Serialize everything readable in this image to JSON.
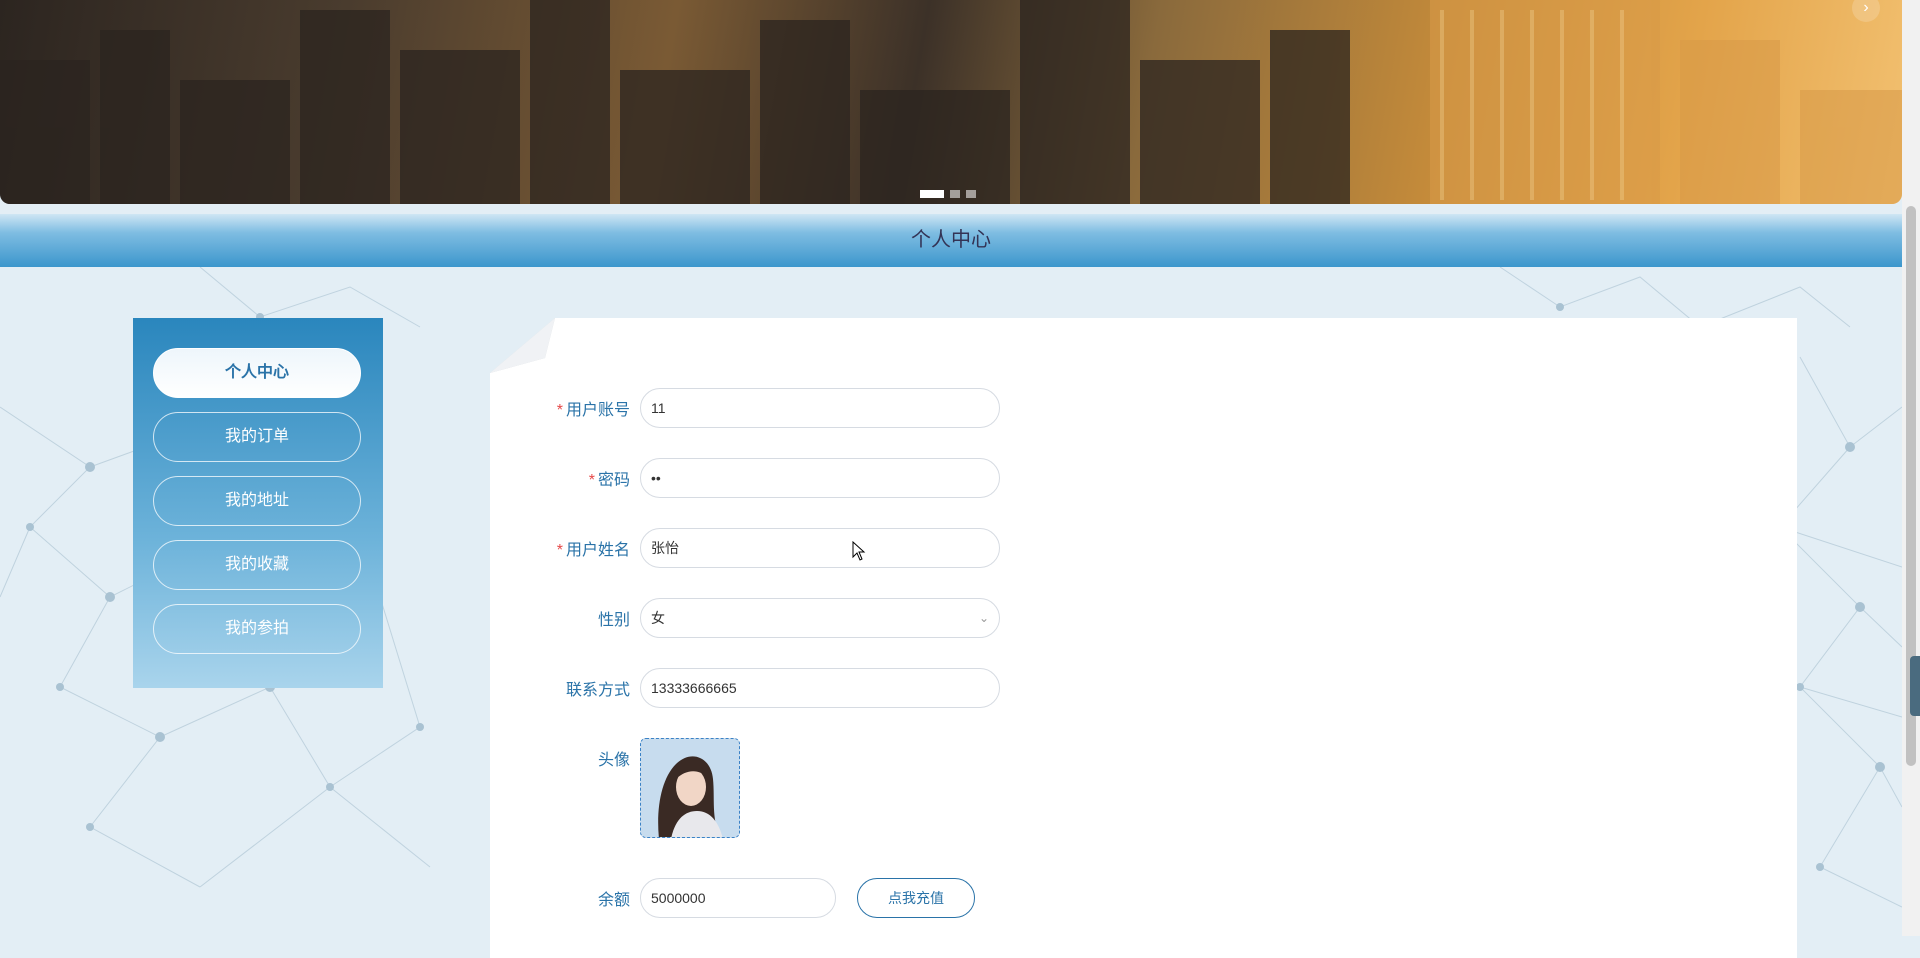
{
  "header": {
    "title": "个人中心"
  },
  "carousel": {
    "slide_count": 3,
    "active_index": 0,
    "arrow_label": "›"
  },
  "sidebar": {
    "items": [
      {
        "label": "个人中心",
        "active": true
      },
      {
        "label": "我的订单",
        "active": false
      },
      {
        "label": "我的地址",
        "active": false
      },
      {
        "label": "我的收藏",
        "active": false
      },
      {
        "label": "我的参拍",
        "active": false
      }
    ]
  },
  "form": {
    "account": {
      "label": "用户账号",
      "required": "*",
      "value": "11"
    },
    "password": {
      "label": "密码",
      "required": "*",
      "value": "••"
    },
    "name": {
      "label": "用户姓名",
      "required": "*",
      "value": "张怡"
    },
    "gender": {
      "label": "性别",
      "value": "女"
    },
    "phone": {
      "label": "联系方式",
      "value": "13333666665"
    },
    "avatar": {
      "label": "头像"
    },
    "balance": {
      "label": "余额",
      "value": "5000000",
      "button": "点我充值"
    }
  },
  "colors": {
    "accent": "#2a73a8",
    "required": "#e54848"
  }
}
